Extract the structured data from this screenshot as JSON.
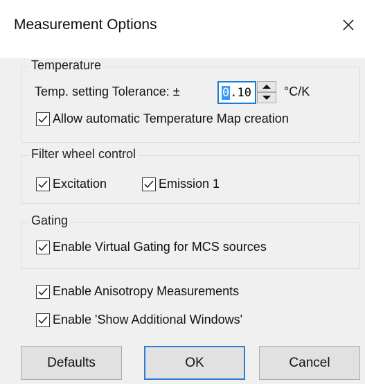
{
  "window": {
    "title": "Measurement Options"
  },
  "icons": {
    "close": "close-icon",
    "check": "checkmark-icon",
    "spin_up": "arrow-up-icon",
    "spin_down": "arrow-down-icon"
  },
  "temperature": {
    "label": "Temperature",
    "tolerance_label": "Temp. setting Tolerance: ±",
    "tolerance_value": "0.10",
    "tolerance_value_first": "0",
    "tolerance_value_rest": ".10",
    "unit": "°C/K",
    "auto_map_label": "Allow automatic Temperature Map creation",
    "auto_map_checked": true
  },
  "filter_wheel": {
    "label": "Filter wheel control",
    "excitation_label": "Excitation",
    "excitation_checked": true,
    "emission_label": "Emission 1",
    "emission_checked": true
  },
  "gating": {
    "label": "Gating",
    "virtual_gating_label": "Enable Virtual Gating for MCS sources",
    "virtual_gating_checked": true
  },
  "options": {
    "anisotropy_label": "Enable Anisotropy Measurements",
    "anisotropy_checked": true,
    "additional_windows_label": "Enable 'Show Additional Windows'",
    "additional_windows_checked": true
  },
  "buttons": {
    "defaults": "Defaults",
    "ok": "OK",
    "cancel": "Cancel"
  },
  "colors": {
    "accent": "#2b7cd3",
    "selection": "#3399ff",
    "dialog_bg": "#f0f0f0"
  }
}
